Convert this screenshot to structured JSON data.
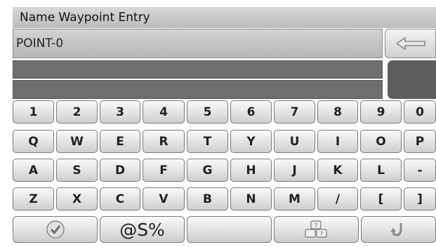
{
  "title": "Name Waypoint Entry",
  "entry": {
    "value": "POINT-0"
  },
  "icons": {
    "back": "back-arrow-icon",
    "confirm": "checkmark-icon",
    "layout": "keyboard-layout-icon",
    "rotate": "rotate-icon"
  },
  "keyboard": {
    "rows": [
      [
        "1",
        "2",
        "3",
        "4",
        "5",
        "6",
        "7",
        "8",
        "9",
        "0"
      ],
      [
        "Q",
        "W",
        "E",
        "R",
        "T",
        "Y",
        "U",
        "I",
        "O",
        "P"
      ],
      [
        "A",
        "S",
        "D",
        "F",
        "G",
        "H",
        "J",
        "K",
        "L",
        "-"
      ],
      [
        "Z",
        "X",
        "C",
        "V",
        "B",
        "N",
        "M",
        "/",
        "[",
        "]"
      ]
    ]
  },
  "bottom_bar": {
    "symbols_label": "@S%",
    "space_label": ""
  }
}
